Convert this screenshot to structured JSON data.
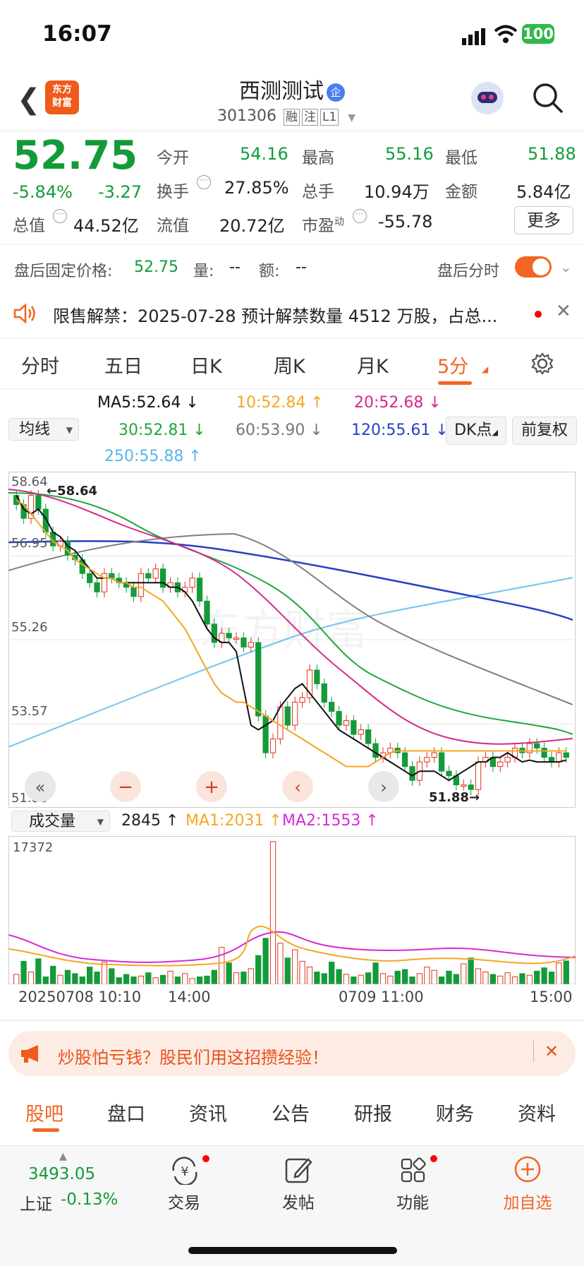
{
  "status": {
    "time": "16:07",
    "battery": "100"
  },
  "header": {
    "logo": "东方\n财富",
    "title": "西测测试",
    "badge": "企",
    "code": "301306",
    "tags": [
      "融",
      "注",
      "L1"
    ]
  },
  "quote": {
    "price": "52.75",
    "pct": "-5.84%",
    "chg": "-3.27",
    "fields": [
      {
        "label": "今开",
        "value": "54.16"
      },
      {
        "label": "最高",
        "value": "55.16"
      },
      {
        "label": "最低",
        "value": "51.88"
      },
      {
        "label": "换手",
        "value": "27.85%"
      },
      {
        "label": "总手",
        "value": "10.94万"
      },
      {
        "label": "金额",
        "value": "5.84亿"
      },
      {
        "label": "总值",
        "value": "44.52亿"
      },
      {
        "label": "流值",
        "value": "20.72亿"
      },
      {
        "label": "市盈",
        "sup": "动",
        "value": "-55.78"
      }
    ],
    "more": "更多"
  },
  "afterhours": {
    "label": "盘后固定价格:",
    "price": "52.75",
    "vol_label": "量:",
    "vol": "--",
    "amt_label": "额:",
    "amt": "--",
    "toggle_label": "盘后分时"
  },
  "notice": {
    "text": "限售解禁：2025-07-28 预计解禁数量 4512 万股，占总..."
  },
  "tabs": [
    {
      "label": "分时"
    },
    {
      "label": "五日"
    },
    {
      "label": "日K"
    },
    {
      "label": "周K"
    },
    {
      "label": "月K"
    },
    {
      "label": "5分"
    }
  ],
  "indicators": {
    "ma_select": "均线",
    "ma5": "MA5:52.64 ↓",
    "ma10": "10:52.84 ↑",
    "ma20": "20:52.68 ↓",
    "ma30": "30:52.81 ↓",
    "ma60": "60:53.90 ↓",
    "ma120": "120:55.61 ↓",
    "ma250": "250:55.88 ↑",
    "dk": "DK点",
    "fq": "前复权"
  },
  "colors": {
    "ma5": "#111111",
    "ma10": "#f5a623",
    "ma20": "#d6278a",
    "ma30": "#1fa83a",
    "ma60": "#888888",
    "ma120": "#2442c4",
    "ma250": "#73c3f0",
    "up": "#e0321e",
    "down": "#139b3a",
    "accent": "#f26522"
  },
  "chart_data": {
    "type": "candlestick",
    "y_ticks": [
      "58.64",
      "56.95",
      "55.26",
      "53.57",
      "51.88"
    ],
    "ylim": [
      51.88,
      58.64
    ],
    "high_label": "58.64",
    "low_label": "51.88",
    "close": [
      58.2,
      57.9,
      58.4,
      58.1,
      57.6,
      57.3,
      57.4,
      57.1,
      57.0,
      56.7,
      56.5,
      56.3,
      56.7,
      56.6,
      56.5,
      56.4,
      56.2,
      56.7,
      56.6,
      56.8,
      56.4,
      56.5,
      56.3,
      56.4,
      56.6,
      56.1,
      55.6,
      55.2,
      55.4,
      55.3,
      55.3,
      55.1,
      55.2,
      53.6,
      52.8,
      53.1,
      53.8,
      53.4,
      53.9,
      54.0,
      54.6,
      54.3,
      53.9,
      53.7,
      53.4,
      53.5,
      53.2,
      53.3,
      53.0,
      52.7,
      52.8,
      52.9,
      52.8,
      52.5,
      52.2,
      52.6,
      52.7,
      52.8,
      52.4,
      52.3,
      52.1,
      52.1,
      52.0,
      52.6,
      52.7,
      52.5,
      52.6,
      52.7,
      52.9,
      52.8,
      53.0,
      52.9,
      52.7,
      52.6,
      52.8,
      52.7
    ],
    "ma5": [
      58.4,
      58.1,
      58.0,
      58.1,
      57.9,
      57.6,
      57.5,
      57.3,
      57.2,
      57.0,
      56.8,
      56.6,
      56.6,
      56.6,
      56.5,
      56.5,
      56.5,
      56.5,
      56.5,
      56.5,
      56.5,
      56.4,
      56.4,
      56.3,
      56.1,
      55.8,
      55.5,
      55.3,
      55.2,
      55.2,
      55.0,
      54.2,
      53.4,
      53.3,
      53.4,
      53.5,
      53.8,
      54.0,
      54.2,
      54.3,
      54.1,
      53.9,
      53.7,
      53.5,
      53.3,
      53.2,
      53.1,
      53.0,
      52.9,
      52.8,
      52.7,
      52.6,
      52.5,
      52.4,
      52.3,
      52.4,
      52.4,
      52.4,
      52.3,
      52.2,
      52.3,
      52.4,
      52.5,
      52.6,
      52.6,
      52.7,
      52.7,
      52.8,
      52.7,
      52.6,
      52.64,
      52.6,
      52.6,
      52.6,
      52.6,
      52.64
    ],
    "ma10": [
      58.3,
      58.2,
      58.0,
      57.8,
      57.6,
      57.4,
      57.3,
      57.2,
      57.0,
      56.9,
      56.8,
      56.7,
      56.6,
      56.6,
      56.5,
      56.5,
      56.4,
      56.4,
      56.3,
      56.2,
      56.1,
      55.9,
      55.7,
      55.5,
      55.2,
      54.9,
      54.6,
      54.3,
      54.1,
      54.0,
      53.9,
      53.9,
      53.8,
      53.7,
      53.6,
      53.5,
      53.4,
      53.3,
      53.2,
      53.1,
      53.0,
      52.9,
      52.8,
      52.7,
      52.6,
      52.5,
      52.5,
      52.5,
      52.5,
      52.6,
      52.7,
      52.8,
      52.84,
      52.84,
      52.84,
      52.84,
      52.84,
      52.84,
      52.84,
      52.84,
      52.84,
      52.84,
      52.84,
      52.84,
      52.84,
      52.84,
      52.84,
      52.84,
      52.84,
      52.84,
      52.84,
      52.84,
      52.84,
      52.84,
      52.84,
      52.84
    ],
    "volume": {
      "current": "2845 ↑",
      "ma1": "MA1:2031 ↑",
      "ma2": "MA2:1553 ↑",
      "max_label": "17372",
      "ylim": [
        0,
        17372
      ]
    },
    "volumes": [
      1200,
      2800,
      1500,
      3100,
      900,
      2200,
      1100,
      1700,
      1300,
      900,
      2100,
      1500,
      2700,
      1900,
      800,
      1200,
      900,
      1000,
      1400,
      800,
      1100,
      1600,
      900,
      1300,
      700,
      900,
      1000,
      1700,
      4500,
      2600,
      1400,
      1500,
      1900,
      3500,
      5600,
      17372,
      5000,
      3200,
      4200,
      2800,
      2100,
      1500,
      1300,
      2700,
      1800,
      1200,
      900,
      1100,
      1400,
      2600,
      1300,
      1000,
      1600,
      1800,
      900,
      1300,
      2100,
      1700,
      900,
      1600,
      1200,
      2500,
      3200,
      1900,
      1500,
      1200,
      1000,
      1400,
      900,
      1300,
      1100,
      1600,
      2000,
      1500,
      2600,
      2845
    ],
    "x_ticks": [
      "20250708 10:10",
      "14:00",
      "0709 11:00",
      "15:00"
    ],
    "vol_select": "成交量"
  },
  "banner": {
    "text": "炒股怕亏钱？股民们用这招攒经验！"
  },
  "bottom_tabs": [
    {
      "label": "股吧"
    },
    {
      "label": "盘口"
    },
    {
      "label": "资讯"
    },
    {
      "label": "公告"
    },
    {
      "label": "研报"
    },
    {
      "label": "财务"
    },
    {
      "label": "资料"
    }
  ],
  "bottom_nav": {
    "index_value": "3493.05",
    "index_name": "上证",
    "index_pct": "-0.13%",
    "items": [
      {
        "label": "交易"
      },
      {
        "label": "发帖"
      },
      {
        "label": "功能"
      },
      {
        "label": "加自选"
      }
    ]
  },
  "watermark": "东方财富"
}
